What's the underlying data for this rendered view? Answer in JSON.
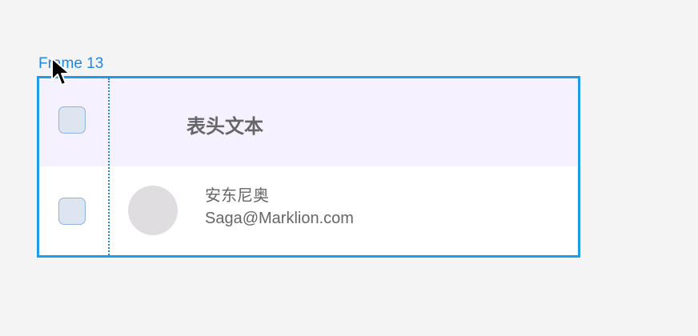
{
  "frame": {
    "label": "Frame 13"
  },
  "table": {
    "header": {
      "title": "表头文本"
    },
    "rows": [
      {
        "name": "安东尼奥",
        "email": "Saga@Marklion.com"
      }
    ]
  },
  "icons": {
    "cursor": "cursor-icon"
  },
  "colors": {
    "selection": "#1e9be9",
    "header_background": "#f6f1ff",
    "checkbox_fill": "#dde5f1",
    "avatar_fill": "#dfdddf"
  }
}
